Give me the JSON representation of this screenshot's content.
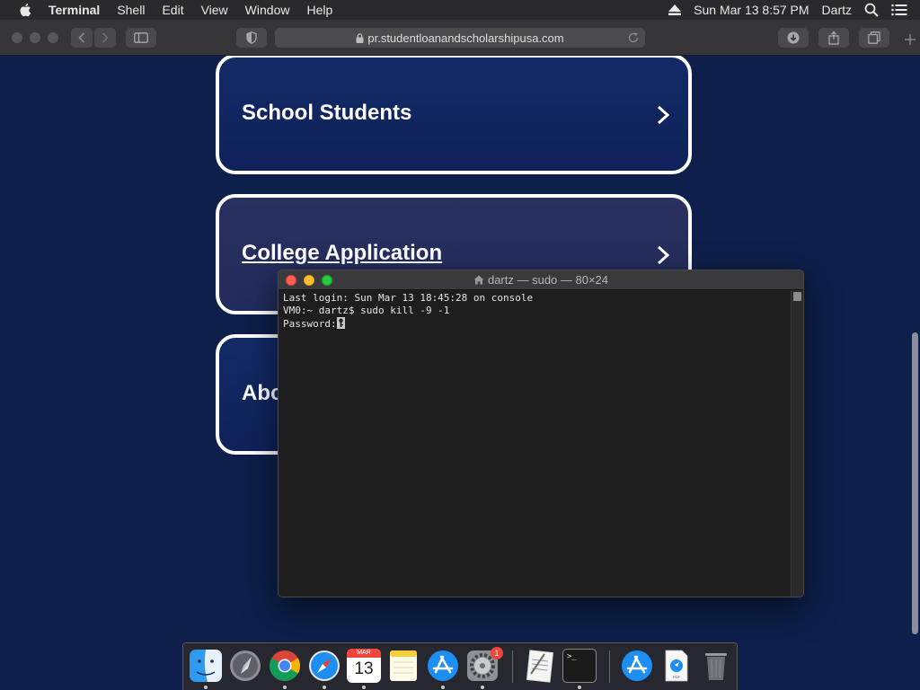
{
  "menubar": {
    "app": "Terminal",
    "items": [
      "Shell",
      "Edit",
      "View",
      "Window",
      "Help"
    ],
    "datetime": "Sun Mar 13  8:57 PM",
    "user": "Dartz"
  },
  "browser": {
    "url": "pr.studentloanandscholarshipusa.com"
  },
  "page": {
    "cards": [
      {
        "label": "School Students"
      },
      {
        "label": "College Application"
      },
      {
        "label": "Abo"
      }
    ]
  },
  "terminal": {
    "title": "dartz — sudo — 80×24",
    "lines": [
      "Last login: Sun Mar 13 18:45:28 on console",
      "VM0:~ dartz$ sudo kill -9 -1",
      "Password:"
    ]
  },
  "dock": {
    "calendar_month": "MAR",
    "calendar_day": "13",
    "sysprefs_badge": "1",
    "terminal_prompt": ">_",
    "preview_label": "PDF"
  }
}
